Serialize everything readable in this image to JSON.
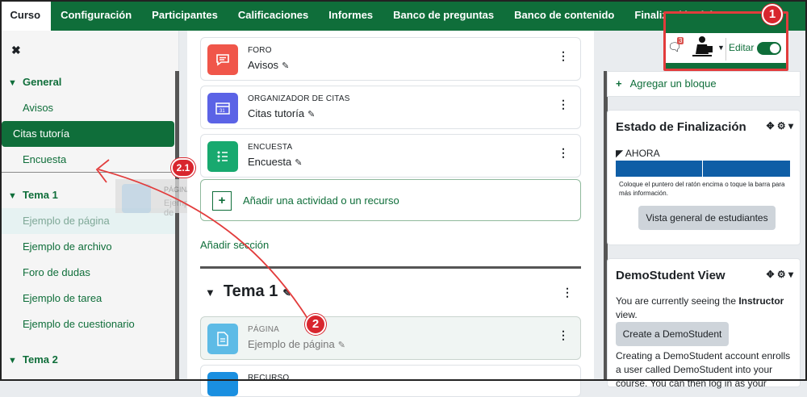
{
  "topnav": {
    "tabs": [
      "Curso",
      "Configuración",
      "Participantes",
      "Calificaciones",
      "Informes",
      "Banco de preguntas",
      "Banco de contenido",
      "Finalización del curso"
    ]
  },
  "drawer": {
    "items": [
      {
        "label": "General",
        "type": "section"
      },
      {
        "label": "Avisos",
        "type": "item"
      },
      {
        "label": "Citas tutoría",
        "type": "active"
      },
      {
        "label": "Encuesta",
        "type": "item"
      },
      {
        "label": "Tema 1",
        "type": "section"
      },
      {
        "label": "Ejemplo de página",
        "type": "faded"
      },
      {
        "label": "Ejemplo de archivo",
        "type": "item"
      },
      {
        "label": "Foro de dudas",
        "type": "item"
      },
      {
        "label": "Ejemplo de tarea",
        "type": "item"
      },
      {
        "label": "Ejemplo de cuestionario",
        "type": "item"
      },
      {
        "label": "Tema 2",
        "type": "section"
      }
    ],
    "ghost": {
      "type": "PÁGINA",
      "name": "Ejemplo de"
    }
  },
  "main": {
    "activities": [
      {
        "type": "FORO",
        "name": "Avisos",
        "color": "#f0564a",
        "icon": "forum-icon"
      },
      {
        "type": "ORGANIZADOR DE CITAS",
        "name": "Citas tutoría",
        "color": "#5b63e6",
        "icon": "scheduler-icon"
      },
      {
        "type": "ENCUESTA",
        "name": "Encuesta",
        "color": "#18a96f",
        "icon": "survey-icon"
      }
    ],
    "add_activity": "Añadir una actividad o un recurso",
    "add_section": "Añadir sección",
    "section_title": "Tema 1",
    "section_items": [
      {
        "type": "PÁGINA",
        "name": "Ejemplo de página",
        "color": "#5dbbe6",
        "icon": "page-icon"
      },
      {
        "type": "RECURSO",
        "name": "",
        "color": "#1a8fe0",
        "icon": "file-icon"
      }
    ]
  },
  "right": {
    "add_block": "Agregar un bloque",
    "completion": {
      "title": "Estado de Finalización",
      "now_label": "AHORA",
      "hint": "Coloque el puntero del ratón encima o toque la barra para más información.",
      "button": "Vista general de estudiantes"
    },
    "demostudent": {
      "title": "DemoStudent View",
      "text_a": "You are currently seeing the ",
      "text_b": "Instructor",
      "text_c": " view.",
      "button": "Create a DemoStudent",
      "text2": "Creating a DemoStudent account enrolls a user called DemoStudent into your course. You can then log in as your"
    }
  },
  "header_tools": {
    "message_count": "3",
    "edit_label": "Editar",
    "edit_mode": true
  },
  "callouts": {
    "one": "1",
    "two": "2",
    "two_one": "2.1"
  },
  "colors": {
    "brand": "#0f6e3a",
    "annotation": "#e23c3c"
  }
}
